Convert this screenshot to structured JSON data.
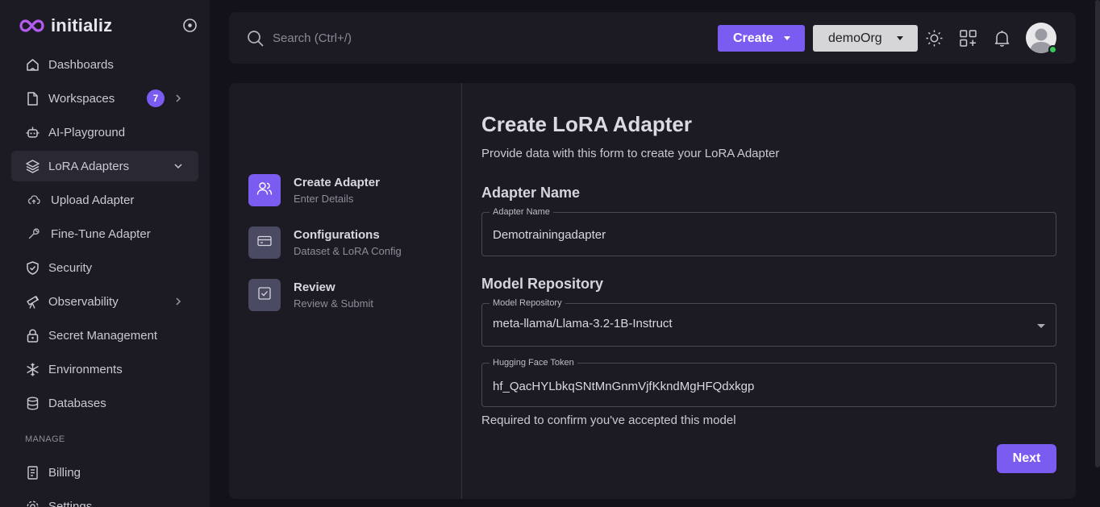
{
  "brand": {
    "name": "initializ"
  },
  "sidebar": {
    "items": [
      {
        "label": "Dashboards"
      },
      {
        "label": "Workspaces",
        "badge": "7"
      },
      {
        "label": "AI-Playground"
      },
      {
        "label": "LoRA Adapters"
      },
      {
        "label": "Upload Adapter"
      },
      {
        "label": "Fine-Tune Adapter"
      },
      {
        "label": "Security"
      },
      {
        "label": "Observability"
      },
      {
        "label": "Secret Management"
      },
      {
        "label": "Environments"
      },
      {
        "label": "Databases"
      }
    ],
    "manage_label": "MANAGE",
    "manage_items": [
      {
        "label": "Billing"
      },
      {
        "label": "Settings"
      }
    ]
  },
  "topbar": {
    "search_placeholder": "Search (Ctrl+/)",
    "create_label": "Create",
    "org_label": "demoOrg"
  },
  "steps": [
    {
      "title": "Create Adapter",
      "subtitle": "Enter Details"
    },
    {
      "title": "Configurations",
      "subtitle": "Dataset & LoRA Config"
    },
    {
      "title": "Review",
      "subtitle": "Review & Submit"
    }
  ],
  "form": {
    "title": "Create LoRA Adapter",
    "description": "Provide data with this form to create your LoRA Adapter",
    "adapter_section": "Adapter Name",
    "adapter_label": "Adapter Name",
    "adapter_value": "Demotrainingadapter",
    "model_section": "Model Repository",
    "model_label": "Model Repository",
    "model_value": "meta-llama/Llama-3.2-1B-Instruct",
    "token_label": "Hugging Face Token",
    "token_value": "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",
    "helper": "Required to confirm you've accepted this model",
    "next_label": "Next"
  },
  "colors": {
    "accent": "#7b5cf0",
    "sidebar_bg": "#1c1b24",
    "page_bg": "#13121a",
    "online": "#34c759"
  }
}
